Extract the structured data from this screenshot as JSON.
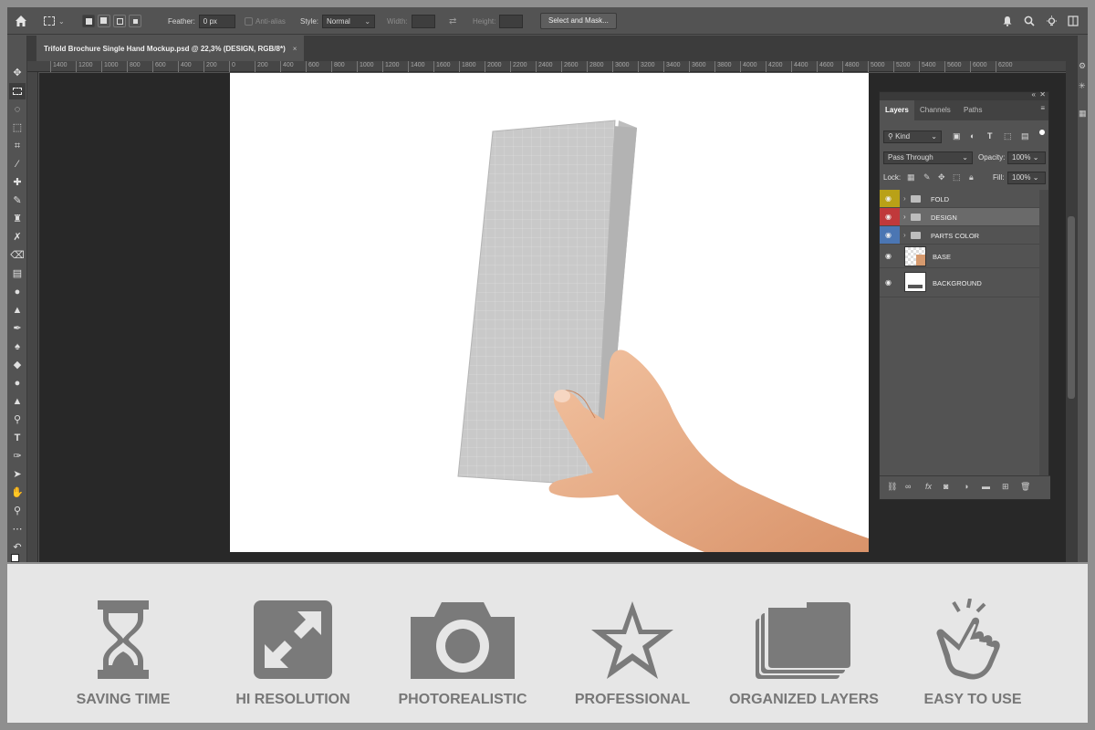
{
  "options_bar": {
    "feather_label": "Feather:",
    "feather_value": "0 px",
    "antialias_label": "Anti-alias",
    "style_label": "Style:",
    "style_value": "Normal",
    "width_label": "Width:",
    "height_label": "Height:",
    "select_mask_button": "Select and Mask..."
  },
  "document_tab": {
    "title": "Trifold Brochure Single Hand Mockup.psd @ 22,3% (DESIGN, RGB/8*)",
    "close": "×"
  },
  "ruler_labels": [
    "1400",
    "1200",
    "1000",
    "800",
    "600",
    "400",
    "200",
    "0",
    "200",
    "400",
    "600",
    "800",
    "1000",
    "1200",
    "1400",
    "1600",
    "1800",
    "2000",
    "2200",
    "2400",
    "2600",
    "2800",
    "3000",
    "3200",
    "3400",
    "3600",
    "3800",
    "4000",
    "4200",
    "4400",
    "4600",
    "4800",
    "5000",
    "5200",
    "5400",
    "5600",
    "6000",
    "6200"
  ],
  "layers_panel": {
    "tabs": [
      "Layers",
      "Channels",
      "Paths"
    ],
    "filter_kind": "Kind",
    "blend_mode": "Pass Through",
    "opacity_label": "Opacity:",
    "opacity_value": "100%",
    "lock_label": "Lock:",
    "fill_label": "Fill:",
    "fill_value": "100%",
    "layers": [
      {
        "name": "FOLD",
        "type": "group",
        "color": "#b9a117"
      },
      {
        "name": "DESIGN",
        "type": "group",
        "color": "#c0393b",
        "selected": true
      },
      {
        "name": "PARTS COLOR",
        "type": "group",
        "color": "#4b76b3"
      },
      {
        "name": "BASE",
        "type": "layer"
      },
      {
        "name": "BACKGROUND",
        "type": "layer"
      }
    ],
    "bottom_icons": [
      "link-icon",
      "fx-icon",
      "mask-icon",
      "adjustment-icon",
      "new-group-icon",
      "new-layer-icon",
      "trash-icon"
    ]
  },
  "features": [
    {
      "label": "SAVING TIME",
      "icon": "hourglass-icon"
    },
    {
      "label": "HI RESOLUTION",
      "icon": "expand-icon"
    },
    {
      "label": "PHOTOREALISTIC",
      "icon": "camera-icon"
    },
    {
      "label": "PROFESSIONAL",
      "icon": "star-icon"
    },
    {
      "label": "ORGANIZED LAYERS",
      "icon": "layers-icon"
    },
    {
      "label": "EASY TO USE",
      "icon": "tap-hand-icon"
    }
  ],
  "colors": {
    "feature_icon": "#7a7a7a",
    "feature_label": "#777777",
    "app_bg": "#535353",
    "canvas_bg": "#282828"
  }
}
